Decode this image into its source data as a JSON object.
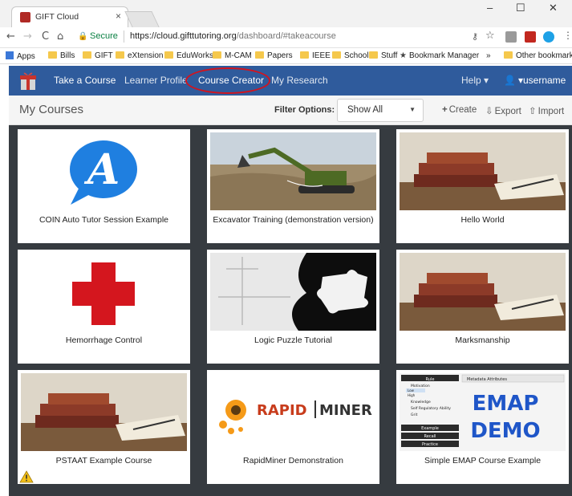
{
  "browser": {
    "tab_title": "GIFT Cloud",
    "tab_close": "×",
    "window_controls": {
      "minimize": "–",
      "maximize": "☐",
      "close": "✕"
    },
    "nav": {
      "back": "←",
      "forward": "→",
      "reload": "C",
      "home": "⌂"
    },
    "secure_label": "Secure",
    "url_host": "https://cloud.gifttutoring.org",
    "url_path": "/dashboard/#takeacourse",
    "icons": [
      "key-icon",
      "star-icon",
      "extension-icon",
      "pdf-icon",
      "skype-icon",
      "menu-icon"
    ]
  },
  "bookmarks": {
    "items": [
      "Apps",
      "Bills",
      "GIFT",
      "eXtension",
      "EduWorks",
      "M-CAM",
      "Papers",
      "IEEE",
      "School",
      "Stuff",
      "Bookmark Manager"
    ],
    "overflow": "»",
    "other": "Other bookmarks"
  },
  "navbar": {
    "take_course": "Take a Course",
    "learner_profile": "Learner Profile",
    "course_creator": "Course Creator",
    "my_research": "My Research",
    "help": "Help ▾",
    "username": "▾username"
  },
  "toolbar": {
    "title": "My Courses",
    "filter_label": "Filter Options:",
    "filter_value": "Show All",
    "create": "Create",
    "export": "Export",
    "import": "Import"
  },
  "courses": [
    {
      "title": "COIN Auto Tutor Session Example",
      "thumb": "coin-a-logo"
    },
    {
      "title": "Excavator Training (demonstration version)",
      "thumb": "excavator"
    },
    {
      "title": "Hello World",
      "thumb": "books"
    },
    {
      "title": "Hemorrhage Control",
      "thumb": "red-cross"
    },
    {
      "title": "Logic Puzzle Tutorial",
      "thumb": "puzzle"
    },
    {
      "title": "Marksmanship",
      "thumb": "books"
    },
    {
      "title": "PSTAAT Example Course",
      "thumb": "books"
    },
    {
      "title": "RapidMiner Demonstration",
      "thumb": "rapidminer-logo"
    },
    {
      "title": "Simple EMAP Course Example",
      "thumb": "emap-demo"
    }
  ],
  "rapidminer_logo": {
    "left": "RAPID",
    "right": "MINER"
  },
  "emap": {
    "line1": "EMAP",
    "line2": "DEMO",
    "panel_rows": [
      "Rule",
      "Motivation",
      "Low",
      "High",
      "Knowledge",
      "Self Regulatory Ability",
      "Grit",
      "Example",
      "Recall",
      "Practice"
    ],
    "panel_header": "Metadata Attributes"
  },
  "colors": {
    "navbar": "#2f5b9c",
    "grid": "#363b40",
    "secure": "#0b8043",
    "circle": "#d2141e"
  }
}
